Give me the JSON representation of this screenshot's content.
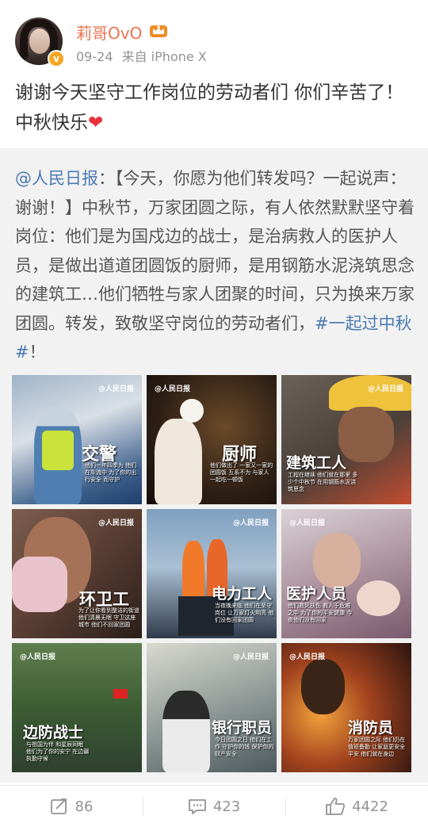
{
  "user": {
    "name": "莉哥OvO",
    "date": "09-24",
    "source": "来自 iPhone X"
  },
  "post": {
    "text": "谢谢今天坚守工作岗位的劳动者们 你们辛苦了！ 中秋快乐",
    "emoji": "❤"
  },
  "repost": {
    "mention": "@人民日报",
    "body": "：【今天，你愿为他们转发吗？一起说声：谢谢！】中秋节，万家团圆之际，有人依然默默坚守着岗位：他们是为国戍边的战士，是治病救人的医护人员，是做出道道团圆饭的厨师，是用钢筋水泥浇筑思念的建筑工…他们牺牲与家人团聚的时间，只为换来万家团圆。转发，致敬坚守岗位的劳动者们，",
    "hashtag": "#一起过中秋#",
    "ending": "！"
  },
  "images": [
    {
      "caption": "交警",
      "sub": "他们一年四季为 他们在车流中 为了你的出行安全 而守护",
      "logo": "@人民日报"
    },
    {
      "caption": "厨师",
      "sub": "他们做出了 一家又一家的团圆饭 互系不为 与家人一起吃一顿饭",
      "logo": "@人民日报"
    },
    {
      "caption": "建筑工人",
      "sub": "工程在继续 他们就在那里 多少个中秋节 在用钢筋水泥浇筑思念",
      "logo": "@人民日报"
    },
    {
      "caption": "环卫工",
      "sub": "为了让你看到整洁的街道 他们清晨无眠 守卫这座城市 他们不回家团圆",
      "logo": "@人民日报"
    },
    {
      "caption": "电力工人",
      "sub": "当夜晚来临 他们在坚守岗位 让万家灯火明亮 他们没有回家团圆",
      "logo": "@人民日报"
    },
    {
      "caption": "医护人员",
      "sub": "他们救死扶伤 救人于危难之中 为了你的平安健康 今夜他们没有回家",
      "logo": "@人民日报"
    },
    {
      "caption": "边防战士",
      "sub": "与祖国为伴 和星辰同眠 他们为了你的安宁 在边疆执勤守候",
      "logo": "@人民日报"
    },
    {
      "caption": "银行职员",
      "sub": "今日团圆之日 他们在工作 守护你的钱 保护你的财产安全",
      "logo": "@人民日报"
    },
    {
      "caption": "消防员",
      "sub": "万家团圆之际 他们仍在值班备勤 让家庭更安全平安 他们就在身边",
      "logo": "@人民日报"
    }
  ],
  "actions": {
    "repost_count": "86",
    "comment_count": "423",
    "like_count": "4422"
  },
  "colors": {
    "username": "#eb7350",
    "link": "#4b7ab3",
    "repost_bg": "#f2f2f2"
  }
}
